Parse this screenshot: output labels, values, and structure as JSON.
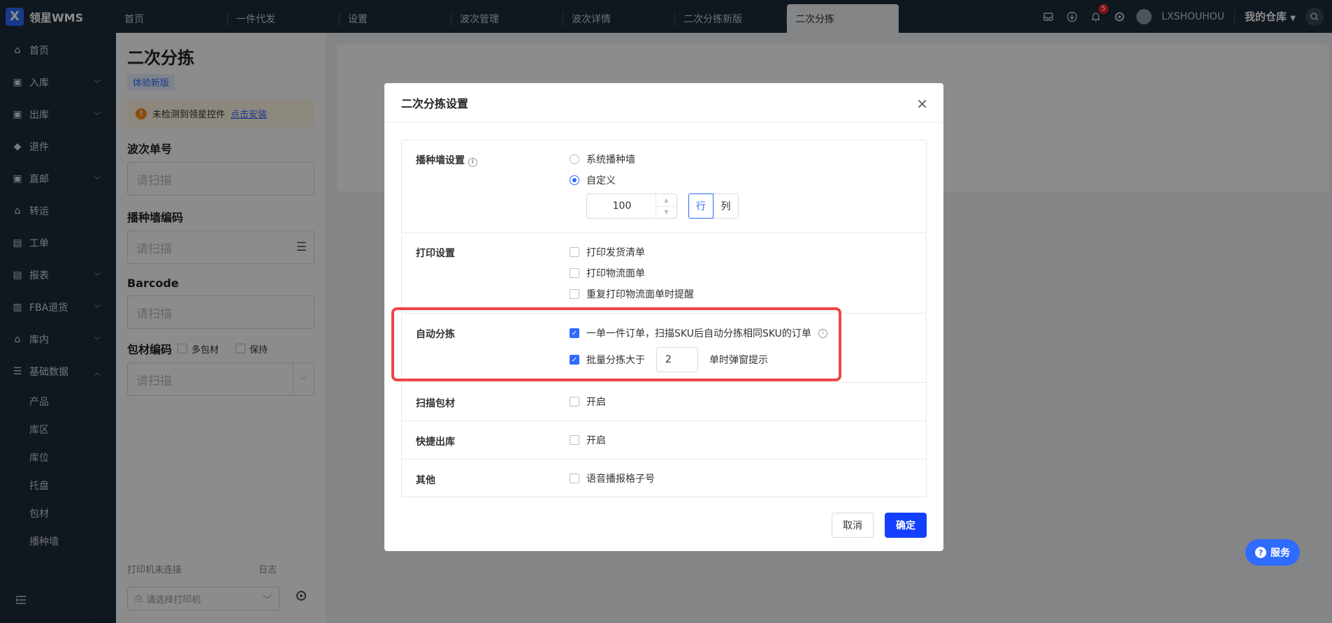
{
  "app": {
    "logo_letter": "X",
    "name": "领星WMS"
  },
  "tabs": [
    "首页",
    "一件代发",
    "设置",
    "波次管理",
    "波次详情",
    "二次分拣新版",
    "二次分拣"
  ],
  "header": {
    "notification_count": "5",
    "username": "LXSHOUHOU",
    "warehouse": "我的仓库"
  },
  "sidebar": {
    "items": [
      {
        "label": "首页",
        "icon": "home-icon",
        "chevron": false
      },
      {
        "label": "入库",
        "icon": "inbound-icon",
        "chevron": true
      },
      {
        "label": "出库",
        "icon": "outbound-icon",
        "chevron": true
      },
      {
        "label": "退件",
        "icon": "return-icon",
        "chevron": false
      },
      {
        "label": "直邮",
        "icon": "direct-mail-icon",
        "chevron": true
      },
      {
        "label": "转运",
        "icon": "transfer-icon",
        "chevron": false
      },
      {
        "label": "工单",
        "icon": "workorder-icon",
        "chevron": false
      },
      {
        "label": "报表",
        "icon": "report-icon",
        "chevron": true
      },
      {
        "label": "FBA退货",
        "icon": "fba-icon",
        "chevron": true
      },
      {
        "label": "库内",
        "icon": "warehouse-icon",
        "chevron": true
      },
      {
        "label": "基础数据",
        "icon": "basic-data-icon",
        "chevron": true,
        "expanded": true
      }
    ],
    "sub_items": [
      "产品",
      "库区",
      "库位",
      "托盘",
      "包材",
      "播种墙"
    ]
  },
  "panel": {
    "title": "二次分拣",
    "tag": "体验新版",
    "alert_text": "未检测到领星控件",
    "alert_link": "点击安装",
    "wave_label": "波次单号",
    "wave_placeholder": "请扫描",
    "wall_label": "播种墙编码",
    "wall_placeholder": "请扫描",
    "barcode_label": "Barcode",
    "barcode_placeholder": "请扫描",
    "pack_label": "包材编码",
    "pack_opt1": "多包材",
    "pack_opt2": "保持",
    "pack_placeholder": "请扫描",
    "printer_status": "打印机未连接",
    "log": "日志",
    "printer_placeholder": "请选择打印机"
  },
  "modal": {
    "title": "二次分拣设置",
    "wall": {
      "label": "播种墙设置",
      "opt_system": "系统播种墙",
      "opt_custom": "自定义",
      "value": "100",
      "seg_row": "行",
      "seg_col": "列"
    },
    "print": {
      "label": "打印设置",
      "opt1": "打印发货清单",
      "opt2": "打印物流面单",
      "opt3": "重复打印物流面单时提醒"
    },
    "auto": {
      "label": "自动分拣",
      "opt1": "一单一件订单，扫描SKU后自动分拣相同SKU的订单",
      "opt2_prefix": "批量分拣大于",
      "opt2_value": "2",
      "opt2_suffix": "单时弹窗提示"
    },
    "scan_pack": {
      "label": "扫描包材",
      "opt": "开启"
    },
    "quick_out": {
      "label": "快捷出库",
      "opt": "开启"
    },
    "other": {
      "label": "其他",
      "opt": "语音播报格子号"
    },
    "cancel": "取消",
    "ok": "确定"
  },
  "service": {
    "label": "服务"
  },
  "colors": {
    "topbar": "#1d2b3a",
    "accent": "#2f6bff",
    "primary_button": "#1340ff",
    "highlight": "#ef4444"
  }
}
